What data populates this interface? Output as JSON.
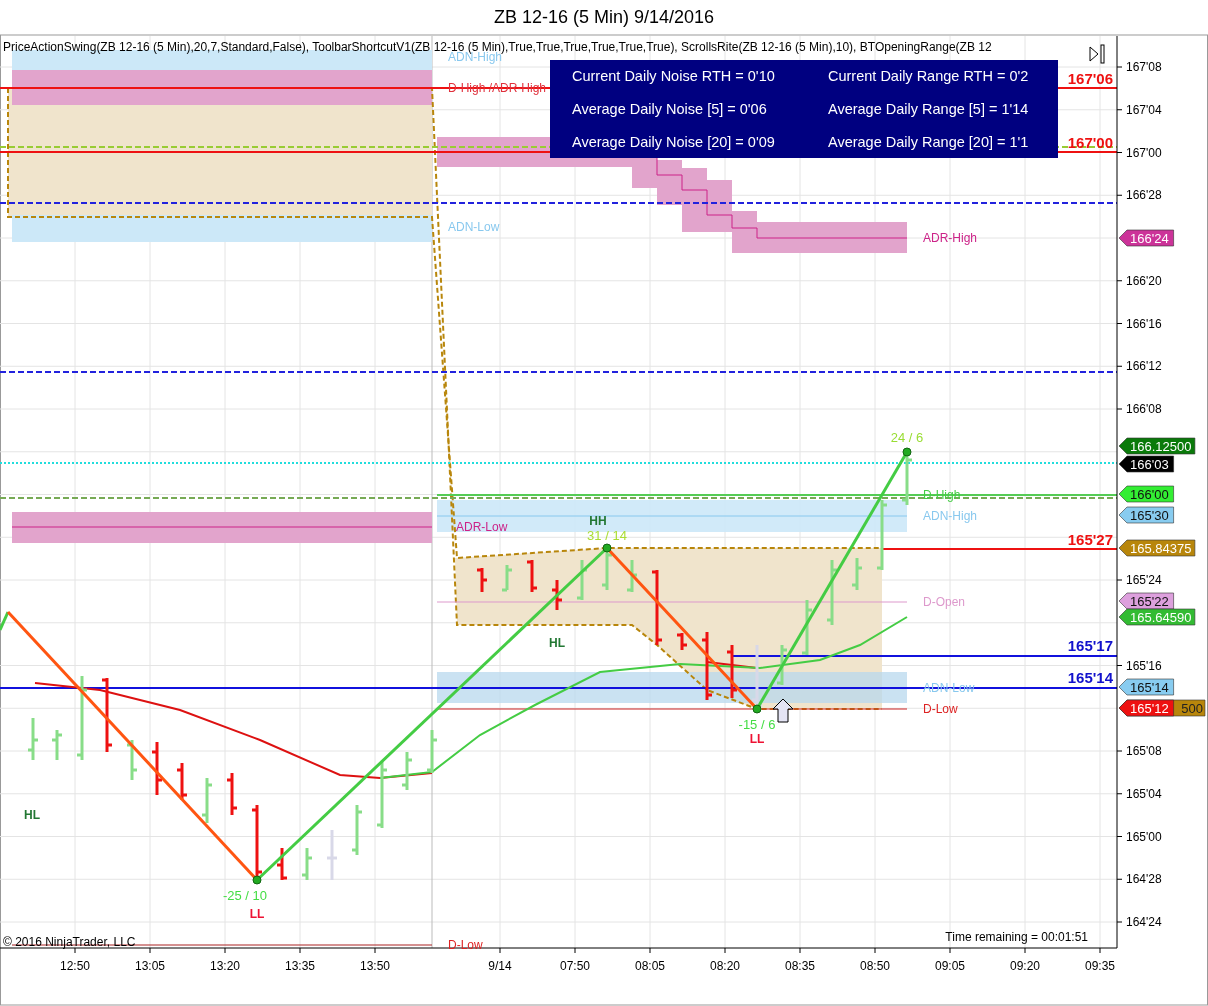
{
  "window": {
    "title": "ZB 12-16 (5 Min)  9/14/2016"
  },
  "indicator_bar": {
    "text": "PriceActionSwing(ZB  12-16  (5  Min),20,7,Standard,False),  ToolbarShortcutV1(ZB  12-16  (5  Min),True,True,True,True,True,True),  ScrollsRite(ZB  12-16  (5  Min),10),  BTOpeningRange(ZB  12"
  },
  "stats_panel": {
    "rows": [
      {
        "noise": "Current Daily Noise RTH = 0'10",
        "range": "Current Daily Range RTH = 0'2"
      },
      {
        "noise": "Average Daily Noise [5] = 0'06",
        "range": "Average Daily Range [5] = 1'14"
      },
      {
        "noise": "Average Daily Noise [20] = 0'09",
        "range": "Average Daily Range [20] = 1'1"
      }
    ]
  },
  "level_labels": [
    {
      "text": "ADN-High",
      "color": "#88c8ee"
    },
    {
      "text": "D-High /ADR-High",
      "color": "#e0303c"
    },
    {
      "text": "ADN-Low",
      "color": "#88c8ee"
    },
    {
      "text": "ADR-High",
      "color": "#cc2288"
    },
    {
      "text": "ADR-Low",
      "color": "#cc2288"
    },
    {
      "text": "D-High",
      "color": "#44cc44"
    },
    {
      "text": "ADN-High",
      "color": "#88c8ee"
    },
    {
      "text": "D-Open",
      "color": "#dd99cc"
    },
    {
      "text": "ADN-Low",
      "color": "#88c8ee"
    },
    {
      "text": "D-Low",
      "color": "#dd2222"
    },
    {
      "text": "D-Low",
      "color": "#dd2222"
    }
  ],
  "swing_labels": [
    {
      "text": "24 / 6",
      "kind": "count",
      "color": "#99dd33"
    },
    {
      "text": "HH",
      "kind": "pivot",
      "color": "#227733"
    },
    {
      "text": "31 / 14",
      "kind": "count",
      "color": "#aadd33"
    },
    {
      "text": "HL",
      "kind": "pivot",
      "color": "#227733"
    },
    {
      "text": "-15 / 6",
      "kind": "count",
      "color": "#44dd44"
    },
    {
      "text": "LL",
      "kind": "pivot",
      "color": "#ee1133"
    },
    {
      "text": "-25 / 10",
      "kind": "count",
      "color": "#44dd44"
    },
    {
      "text": "LL",
      "kind": "pivot",
      "color": "#ee1133"
    },
    {
      "text": "HL",
      "kind": "pivot",
      "color": "#227733"
    }
  ],
  "price_lines": [
    {
      "text": "167'06",
      "color": "#ee1111"
    },
    {
      "text": "167'00",
      "color": "#ee1111"
    },
    {
      "text": "165'27",
      "color": "#ee1111"
    },
    {
      "text": "165'17",
      "color": "#1111cc"
    },
    {
      "text": "165'14",
      "color": "#1111cc"
    }
  ],
  "price_axis": {
    "ticks": [
      "167'08",
      "167'04",
      "167'00",
      "166'28",
      "166'20",
      "166'16",
      "166'12",
      "166'08",
      "165'24",
      "165'16",
      "165'08",
      "165'04",
      "165'00",
      "164'28",
      "164'24"
    ]
  },
  "price_markers": [
    {
      "text": "166'24",
      "color": "#cc3399"
    },
    {
      "text": "166.12500",
      "color": "#0a7a0a"
    },
    {
      "text": "166'03",
      "color": "#000000"
    },
    {
      "text": "166'00",
      "color": "#33ee33"
    },
    {
      "text": "165'30",
      "color": "#88ccf0"
    },
    {
      "text": "165.84375",
      "color": "#b8860b"
    },
    {
      "text": "165'22",
      "color": "#dda0dd"
    },
    {
      "text": "165.64590",
      "color": "#33bb33"
    },
    {
      "text": "165'14",
      "color": "#88ccf0"
    },
    {
      "text": "165'12",
      "color": "#ee1111"
    },
    {
      "text": "500",
      "kind": "partial",
      "color": "#b8860b"
    }
  ],
  "time_axis": {
    "ticks": [
      "12:50",
      "13:05",
      "13:20",
      "13:35",
      "13:50",
      "9/14",
      "07:50",
      "08:05",
      "08:20",
      "08:35",
      "08:50",
      "09:05",
      "09:20",
      "09:35"
    ]
  },
  "copyright": "© 2016 NinjaTrader, LLC",
  "time_remaining": "Time remaining = 00:01:51"
}
